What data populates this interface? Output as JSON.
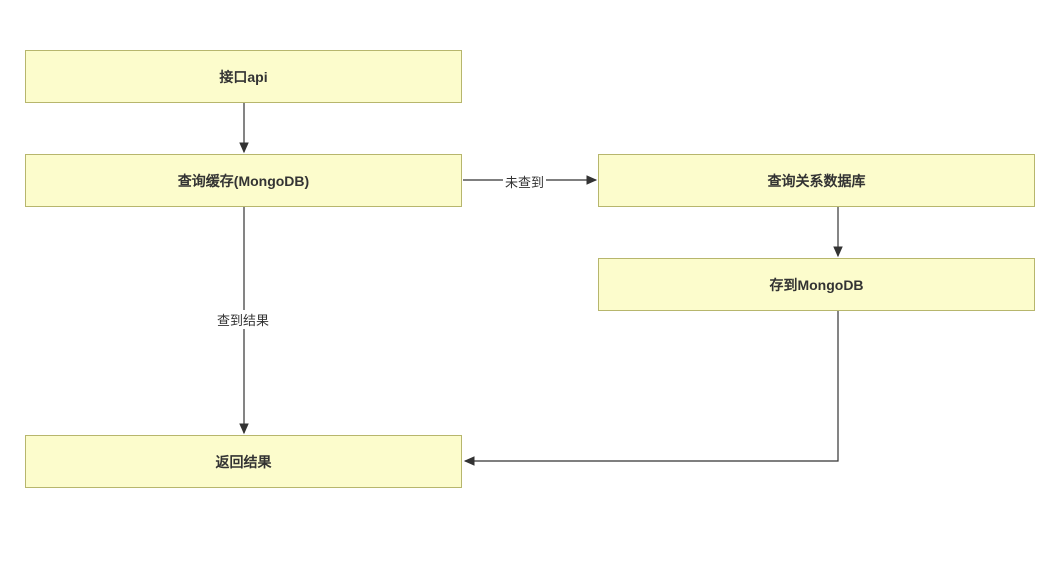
{
  "nodes": {
    "api": {
      "label": "接口api"
    },
    "query_cache": {
      "label": "查询缓存(MongoDB)"
    },
    "query_db": {
      "label": "查询关系数据库"
    },
    "save_mongo": {
      "label": "存到MongoDB"
    },
    "return_result": {
      "label": "返回结果"
    }
  },
  "edges": {
    "not_found": {
      "label": "未查到"
    },
    "found": {
      "label": "查到结果"
    }
  }
}
